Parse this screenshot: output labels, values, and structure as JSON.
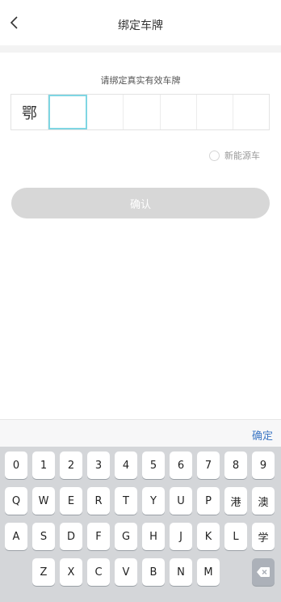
{
  "header": {
    "title": "绑定车牌"
  },
  "form": {
    "instruction": "请绑定真实有效车牌",
    "province": "鄂",
    "plate_cells": [
      "",
      "",
      "",
      "",
      "",
      ""
    ],
    "new_energy_label": "新能源车",
    "new_energy_checked": false,
    "confirm_label": "确认"
  },
  "keyboard": {
    "done_label": "确定",
    "rows": [
      [
        "0",
        "1",
        "2",
        "3",
        "4",
        "5",
        "6",
        "7",
        "8",
        "9"
      ],
      [
        "Q",
        "W",
        "E",
        "R",
        "T",
        "Y",
        "U",
        "P",
        "港",
        "澳"
      ],
      [
        "A",
        "S",
        "D",
        "F",
        "G",
        "H",
        "J",
        "K",
        "L",
        "学"
      ],
      [
        "Z",
        "X",
        "C",
        "V",
        "B",
        "N",
        "M"
      ]
    ],
    "delete_icon": "backspace-icon"
  },
  "colors": {
    "accent": "#3e78c5",
    "active_cell_border": "#7fd6e3",
    "disabled_button": "#d7d7d7",
    "keyboard_bg": "#d4d6d9"
  }
}
